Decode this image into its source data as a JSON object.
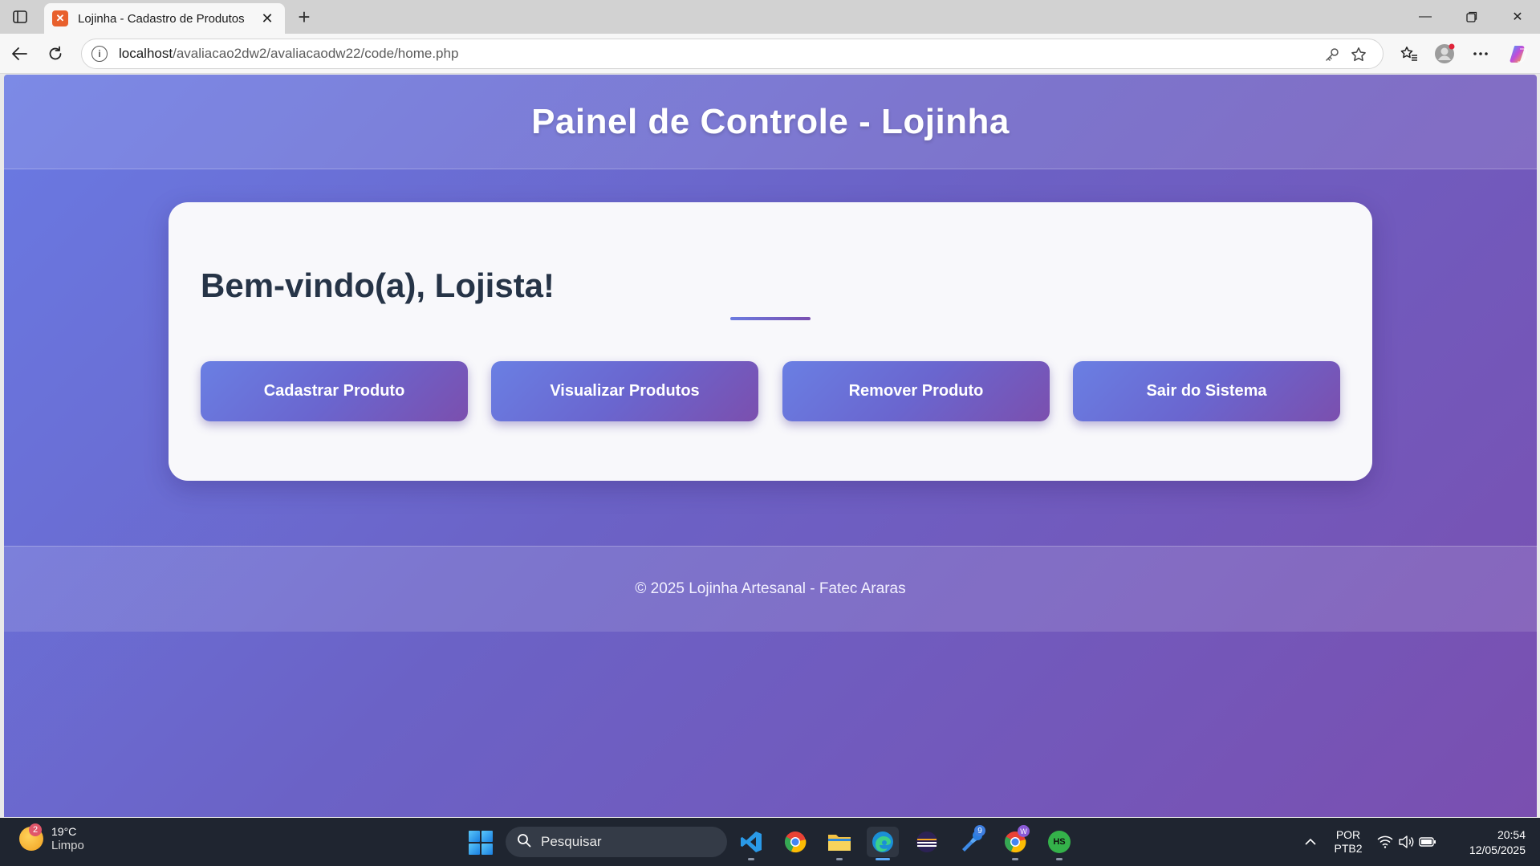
{
  "browser": {
    "tab_title": "Lojinha - Cadastro de Produtos",
    "url_host": "localhost",
    "url_path": "/avaliacao2dw2/avaliacaodw22/code/home.php"
  },
  "page": {
    "header_title": "Painel de Controle - Lojinha",
    "welcome": "Bem-vindo(a), Lojista!",
    "buttons": [
      {
        "label": "Cadastrar Produto"
      },
      {
        "label": "Visualizar Produtos"
      },
      {
        "label": "Remover Produto"
      },
      {
        "label": "Sair do Sistema"
      }
    ],
    "footer": "© 2025 Lojinha Artesanal - Fatec Araras"
  },
  "taskbar": {
    "weather_badge": "2",
    "temperature": "19°C",
    "condition": "Limpo",
    "search_placeholder": "Pesquisar",
    "lang_line1": "POR",
    "lang_line2": "PTB2",
    "time": "20:54",
    "date": "12/05/2025",
    "steam_badge": "9",
    "chrome_profile_badge": "W",
    "hs_label": "HS"
  },
  "colors": {
    "gradient_start": "#6a7ae3",
    "gradient_end": "#7a4fb0",
    "heading": "#263447"
  }
}
